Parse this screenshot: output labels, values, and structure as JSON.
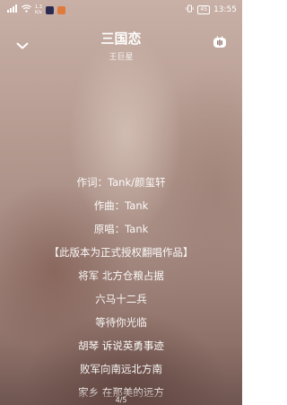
{
  "status_bar": {
    "net_speed_top": "1.3",
    "net_speed_bottom": "K/s",
    "battery": "45",
    "time": "13:55"
  },
  "header": {
    "title": "三国恋",
    "artist": "王巨星"
  },
  "lyrics": [
    "作词：Tank/颜玺轩",
    "作曲：Tank",
    "原唱：Tank",
    "【此版本为正式授权翻唱作品】",
    "将军 北方仓粮占据",
    "六马十二兵",
    "等待你光临",
    "胡琴 诉说英勇事迹",
    "败军向南远北方南",
    "家乡 在那美的远方"
  ],
  "page_indicator": "4/5",
  "icons": {
    "back": "chevron-down-icon",
    "voice": "voice-assistant-icon",
    "wifi": "wifi-icon",
    "signal": "signal-icon"
  }
}
